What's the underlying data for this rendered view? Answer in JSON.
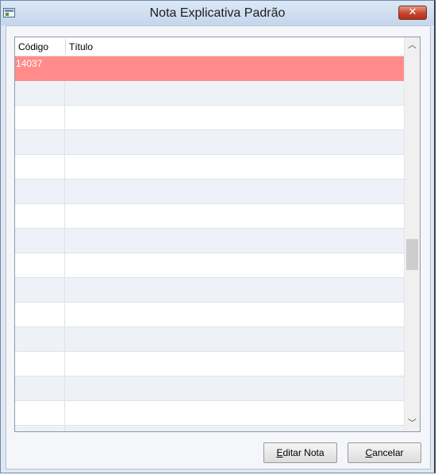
{
  "window": {
    "title": "Nota Explicativa Padrão",
    "close_glyph": "✕"
  },
  "grid": {
    "columns": [
      {
        "label": "Código"
      },
      {
        "label": "Título"
      }
    ],
    "rows": [
      {
        "codigo": "14037",
        "titulo": "",
        "selected": true
      },
      {
        "codigo": "",
        "titulo": ""
      },
      {
        "codigo": "",
        "titulo": ""
      },
      {
        "codigo": "",
        "titulo": ""
      },
      {
        "codigo": "",
        "titulo": ""
      },
      {
        "codigo": "",
        "titulo": ""
      },
      {
        "codigo": "",
        "titulo": ""
      },
      {
        "codigo": "",
        "titulo": ""
      },
      {
        "codigo": "",
        "titulo": ""
      },
      {
        "codigo": "",
        "titulo": ""
      },
      {
        "codigo": "",
        "titulo": ""
      },
      {
        "codigo": "",
        "titulo": ""
      },
      {
        "codigo": "",
        "titulo": ""
      },
      {
        "codigo": "",
        "titulo": ""
      },
      {
        "codigo": "",
        "titulo": ""
      },
      {
        "codigo": "",
        "titulo": ""
      }
    ],
    "selected_row_color": "#ff8c8a",
    "scroll_position": 0.56
  },
  "buttons": {
    "editar": {
      "mnemonic": "E",
      "rest": "ditar Nota"
    },
    "cancelar": {
      "mnemonic": "C",
      "rest": "ancelar"
    }
  },
  "icons": {
    "app": "grid-window-icon",
    "close": "close-icon",
    "scroll_up": "chevron-up-icon",
    "scroll_down": "chevron-down-icon"
  }
}
